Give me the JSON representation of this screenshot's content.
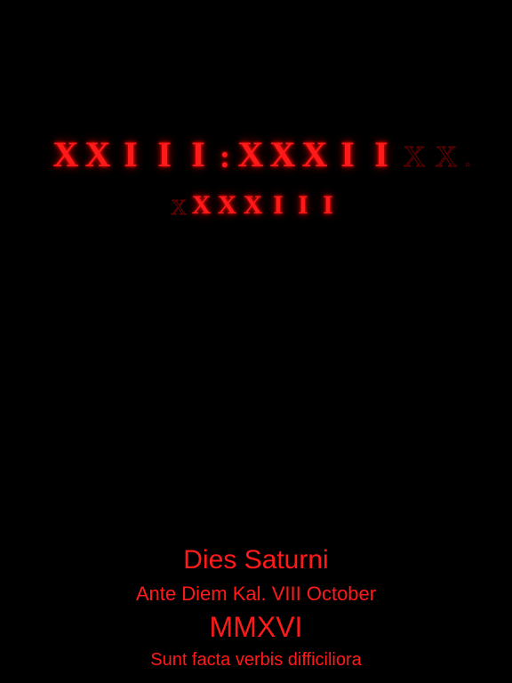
{
  "clock": {
    "hours": [
      "X",
      "X",
      "I",
      "I",
      "I"
    ],
    "separator": ":",
    "minutes": [
      "X",
      "X",
      "X",
      "I",
      "I"
    ],
    "ghost_letters": [
      "X",
      "X"
    ],
    "ghost_label": "R",
    "seconds_ghost": "X",
    "seconds": [
      "X",
      "X",
      "X",
      "I",
      "I",
      "I"
    ]
  },
  "date": {
    "day_name": "Dies Saturni",
    "date_line": "Ante Diem Kal. VIII October",
    "year": "MMXVI",
    "motto": "Sunt facta verbis difficiliora"
  },
  "colors": {
    "background": "#000000",
    "accent": "#ff1a1a"
  }
}
